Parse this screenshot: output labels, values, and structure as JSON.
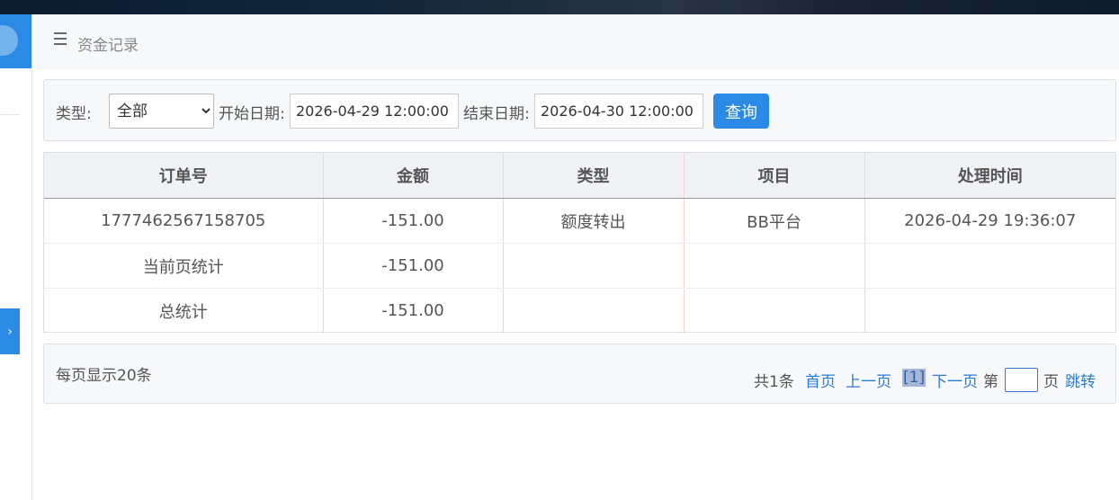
{
  "page": {
    "title": "资金记录"
  },
  "filter": {
    "type_label": "类型:",
    "type_selected": "全部",
    "start_label": "开始日期:",
    "start_value": "2026-04-29 12:00:00",
    "end_label": "结束日期:",
    "end_value": "2026-04-30 12:00:00",
    "query_label": "查询"
  },
  "table": {
    "headers": [
      "订单号",
      "金额",
      "类型",
      "项目",
      "处理时间"
    ],
    "rows": [
      [
        "1777462567158705",
        "-151.00",
        "额度转出",
        "BB平台",
        "2026-04-29 19:36:07"
      ],
      [
        "当前页统计",
        "-151.00",
        "",
        "",
        ""
      ],
      [
        "总统计",
        "-151.00",
        "",
        "",
        ""
      ]
    ]
  },
  "pager": {
    "per_page": "每页显示20条",
    "total": "共1条",
    "first": "首页",
    "prev": "上一页",
    "current": "[1]",
    "next": "下一页",
    "goto_prefix": "第",
    "goto_suffix": "页",
    "jump": "跳转"
  },
  "colors": {
    "accent": "#2b8ae6",
    "link": "#2b7bd0"
  }
}
